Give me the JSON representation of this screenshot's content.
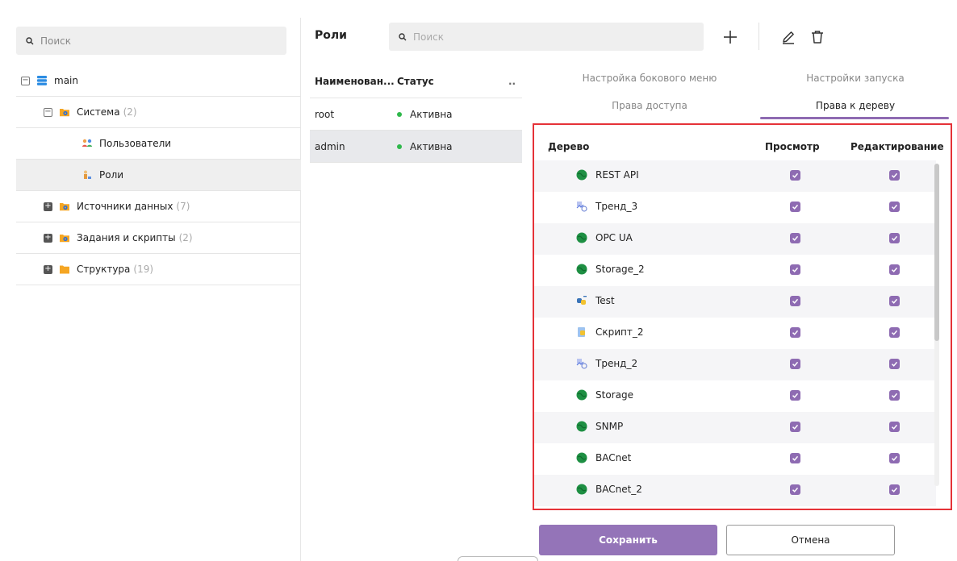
{
  "left": {
    "search_placeholder": "Поиск",
    "tree": [
      {
        "label": "main",
        "count": "",
        "icon": "database-icon",
        "expander": "minus"
      },
      {
        "label": "Система",
        "count": "(2)",
        "icon": "folder-gear-icon",
        "expander": "minus"
      },
      {
        "label": "Пользователи",
        "count": "",
        "icon": "users-icon",
        "expander": ""
      },
      {
        "label": "Роли",
        "count": "",
        "icon": "roles-icon",
        "expander": ""
      },
      {
        "label": "Источники данных",
        "count": "(7)",
        "icon": "folder-gear-icon",
        "expander": "plus"
      },
      {
        "label": "Задания и скрипты",
        "count": "(2)",
        "icon": "folder-gear-icon",
        "expander": "plus"
      },
      {
        "label": "Структура",
        "count": "(19)",
        "icon": "folder-icon",
        "expander": "plus"
      }
    ]
  },
  "mid": {
    "title": "Роли",
    "search_placeholder": "Поиск",
    "columns": {
      "name": "Наименован...",
      "status": "Статус",
      "more": ".."
    },
    "rows": [
      {
        "name": "root",
        "status": "Активна"
      },
      {
        "name": "admin",
        "status": "Активна"
      }
    ]
  },
  "tabs": {
    "sidebar_settings": "Настройка бокового меню",
    "launch_settings": "Настройки запуска",
    "access_rights": "Права доступа",
    "tree_rights": "Права к дереву"
  },
  "tree_rights": {
    "col_tree": "Дерево",
    "col_view": "Просмотр",
    "col_edit": "Редактирование",
    "rows": [
      {
        "label": "REST API",
        "icon": "globe-icon"
      },
      {
        "label": "Тренд_3",
        "icon": "trend-icon"
      },
      {
        "label": "OPC UA",
        "icon": "globe-icon"
      },
      {
        "label": "Storage_2",
        "icon": "globe-icon"
      },
      {
        "label": "Test",
        "icon": "python-script-icon"
      },
      {
        "label": "Скрипт_2",
        "icon": "script-icon"
      },
      {
        "label": "Тренд_2",
        "icon": "trend-icon"
      },
      {
        "label": "Storage",
        "icon": "globe-icon"
      },
      {
        "label": "SNMP",
        "icon": "globe-icon"
      },
      {
        "label": "BACnet",
        "icon": "globe-icon"
      },
      {
        "label": "BACnet_2",
        "icon": "globe-icon"
      }
    ]
  },
  "buttons": {
    "save": "Сохранить",
    "cancel": "Отмена"
  },
  "colors": {
    "accent": "#9474b8",
    "active_dot": "#2fb84b",
    "highlight_border": "#e53238"
  }
}
